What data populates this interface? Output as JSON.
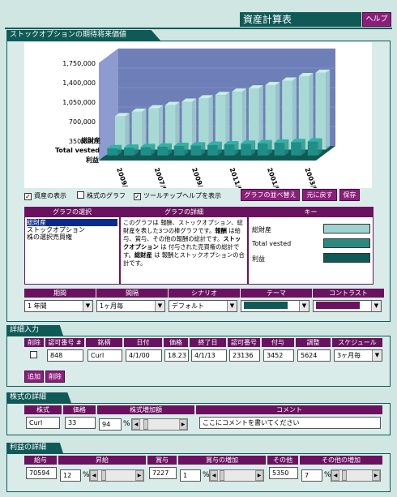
{
  "header": {
    "title": "資産計算表",
    "help_label": "ヘルプ"
  },
  "chart_section": {
    "title": "ストックオプションの期待将来価値",
    "options": {
      "show_assets": "資産の表示",
      "show_stock_graph": "株式のグラフ",
      "show_tooltip_help": "ツールチップヘルプを表示"
    },
    "buttons": {
      "reorder": "グラフの並べ替え",
      "restore": "元に戻す",
      "save": "保存"
    }
  },
  "chart_data": {
    "type": "bar",
    "yticks": [
      "1,750,000",
      "1,400,000",
      "1,050,000",
      "700,000",
      "350,000"
    ],
    "depth_labels": [
      "総財産",
      "Total vested",
      "利益"
    ],
    "x_tick_labels": [
      "2009/ 2/5",
      "2007/01",
      "2009/ 01",
      "2011/01",
      "2001/01",
      "2003/01"
    ],
    "ylim": [
      0,
      1750000
    ],
    "series": [
      {
        "values": [
          600000,
          680000,
          740000,
          800000,
          860000,
          920000,
          980000,
          1040000,
          1100000,
          1160000,
          1240000,
          1320000,
          1380000
        ]
      },
      {
        "values": [
          130000,
          140000,
          150000,
          160000,
          170000,
          180000,
          190000,
          200000,
          210000,
          220000,
          230000,
          240000,
          250000
        ]
      },
      {
        "values": [
          25000,
          25000,
          25000,
          25000,
          25000,
          25000,
          25000,
          25000,
          25000,
          25000,
          25000,
          25000,
          25000
        ]
      }
    ],
    "colors": {
      "front_bar": "#1f8f86",
      "front_top": "#2fb3a7",
      "back_bar": "#a9d9d4",
      "back_top": "#c9eeea",
      "wall": "#6e7fb8",
      "wall_grid": "#8d9bd0",
      "floor": "#0f5a57"
    }
  },
  "graph_select": {
    "header": "グラフの選択",
    "items": [
      "総財産",
      "ストックオプション",
      "株の選択売買権"
    ],
    "selected_index": 0
  },
  "graph_detail": {
    "header": "グラフの詳細",
    "text_1": "このグラフは 報酬、ストックオプション、総財産を表した3つの棒グラフです。",
    "bold_1": "報酬",
    "text_2": " は給与、賞与、その他の報酬の総計です。",
    "bold_2": "ストックオプション",
    "text_3": " は 付与された売買権の総計です。",
    "bold_3": "総財産",
    "text_4": " は 報酬とストックオプションの合計です。"
  },
  "key": {
    "header": "キー",
    "items": [
      {
        "label": "総財産",
        "color": "#9fd3cf"
      },
      {
        "label": "Total vested",
        "color": "#2a8a82"
      },
      {
        "label": "利益",
        "color": "#0f5a57"
      }
    ]
  },
  "controls": {
    "period": {
      "label": "期間",
      "value": "1 年間"
    },
    "interval": {
      "label": "間隔",
      "value": "1ヶ月毎"
    },
    "scenario": {
      "label": "シナリオ",
      "value": "デフォルト"
    },
    "theme": {
      "label": "テーマ",
      "color": "#0f5a57"
    },
    "contrast": {
      "label": "コントラスト",
      "color": "#6a1260"
    }
  },
  "detail_input": {
    "title": "詳細入力",
    "columns": [
      "削除",
      "認可番号 #",
      "銘柄",
      "日付",
      "価格",
      "終了日",
      "認可番号",
      "付与",
      "調整",
      "スケジュール"
    ],
    "row": {
      "grant": "848",
      "symbol": "Curl",
      "date": "4/1/00",
      "price": "18.23",
      "end_date": "4/1/13",
      "grant_no": "23136",
      "vested": "3452",
      "adjust": "5624",
      "schedule": "3ヶ月毎"
    },
    "add_label": "追加",
    "delete_label": "削除"
  },
  "stock_detail": {
    "title": "株式の詳細",
    "columns": [
      "株式",
      "価格",
      "株式増加額",
      "コメント"
    ],
    "stock": "Curl",
    "price": "33",
    "increase": "94",
    "unit": "%",
    "comment_placeholder": "ここにコメントを書いてください"
  },
  "profit_detail": {
    "title": "利益の詳細",
    "columns": [
      "給与",
      "昇給",
      "賞与",
      "賞与の増加",
      "その他",
      "その他の増加"
    ],
    "salary": "70594",
    "raise": "12",
    "bonus": "7227",
    "bonus_increase": "1",
    "other": "5350",
    "other_increase": "7",
    "unit": "%"
  }
}
